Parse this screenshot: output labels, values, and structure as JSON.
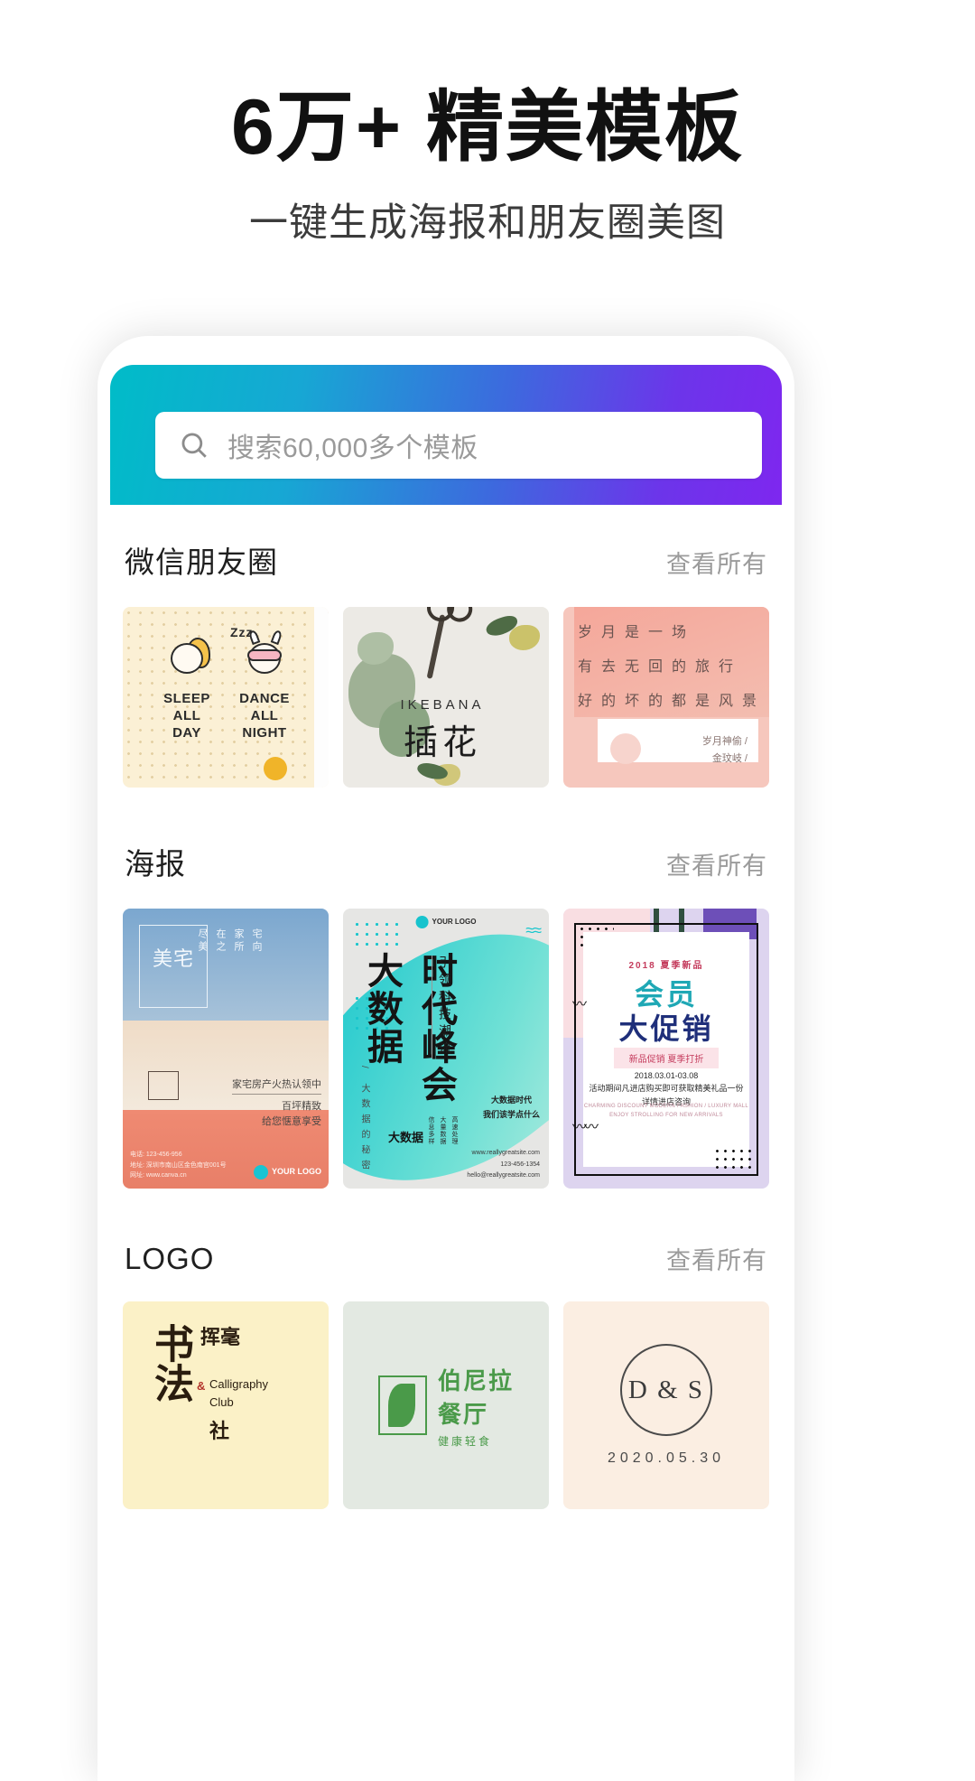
{
  "hero": {
    "title": "6万+ 精美模板",
    "subtitle": "一键生成海报和朋友圈美图"
  },
  "search": {
    "placeholder": "搜索60,000多个模板",
    "icon": "search-icon"
  },
  "sections": [
    {
      "title": "微信朋友圈",
      "more_label": "查看所有",
      "cards": [
        {
          "name": "sleep-all-day-template",
          "texts": [
            "SLEEP",
            "ALL",
            "DAY",
            "DANCE",
            "ALL NIGHT",
            "Zzz"
          ]
        },
        {
          "name": "ikebana-template",
          "texts": [
            "IKEBANA",
            "插花"
          ]
        },
        {
          "name": "pink-poem-template",
          "texts": [
            "岁月是一场",
            "有去无回的旅行",
            "好的坏的都是风景",
            "岁月神偷 /",
            "金玟岐 /"
          ]
        }
      ]
    },
    {
      "title": "海报",
      "more_label": "查看所有",
      "cards": [
        {
          "name": "meizhai-house-poster",
          "texts": [
            "美宅",
            "尽美",
            "在之",
            "家所",
            "宅向",
            "家宅房产火热认领中",
            "百坪精致",
            "给您惬意享受",
            "电话: 123-456-956",
            "地址: 深圳市南山区金色南宫001号",
            "网址: www.canva.cn",
            "YOUR LOGO"
          ]
        },
        {
          "name": "bigdata-summit-poster",
          "texts": [
            "大数据",
            "时代峰会",
            "引领科技潮流",
            "/ 大数据的秘密",
            "大数据时代",
            "我们该学点什么",
            "大数据",
            "信息多样",
            "大量数据",
            "高速处理",
            "www.reallygreatsite.com",
            "123-456-1354",
            "hello@reallygreatsite.com",
            "YOUR LOGO"
          ]
        },
        {
          "name": "member-promo-poster",
          "texts": [
            "2018 夏季新品",
            "会员",
            "大促销",
            "新品促销 夏季打折",
            "2018.03.01-03.08",
            "活动期间凡进店购买即可获取精美礼品一份",
            "详情进店咨询",
            "CHARMING DISCOUNT MODERN FASHION / LUXURY MALL",
            "ENJOY STROLLING FOR NEW ARRIVALS"
          ]
        }
      ]
    },
    {
      "title": "LOGO",
      "more_label": "查看所有",
      "cards": [
        {
          "name": "calligraphy-club-logo",
          "texts": [
            "书法",
            "挥毫",
            "社",
            "&",
            "Calligraphy",
            "Club"
          ]
        },
        {
          "name": "bonila-restaurant-logo",
          "texts": [
            "伯尼拉",
            "餐厅",
            "健康轻食"
          ]
        },
        {
          "name": "ds-monogram-logo",
          "texts": [
            "D & S",
            "2020.05.30"
          ]
        }
      ]
    }
  ],
  "colors": {
    "gradient_start": "#00bcc8",
    "gradient_end": "#7e27ef",
    "title": "#111111",
    "subtitle": "#3c3c3c",
    "more_link": "#9b9b9b"
  }
}
